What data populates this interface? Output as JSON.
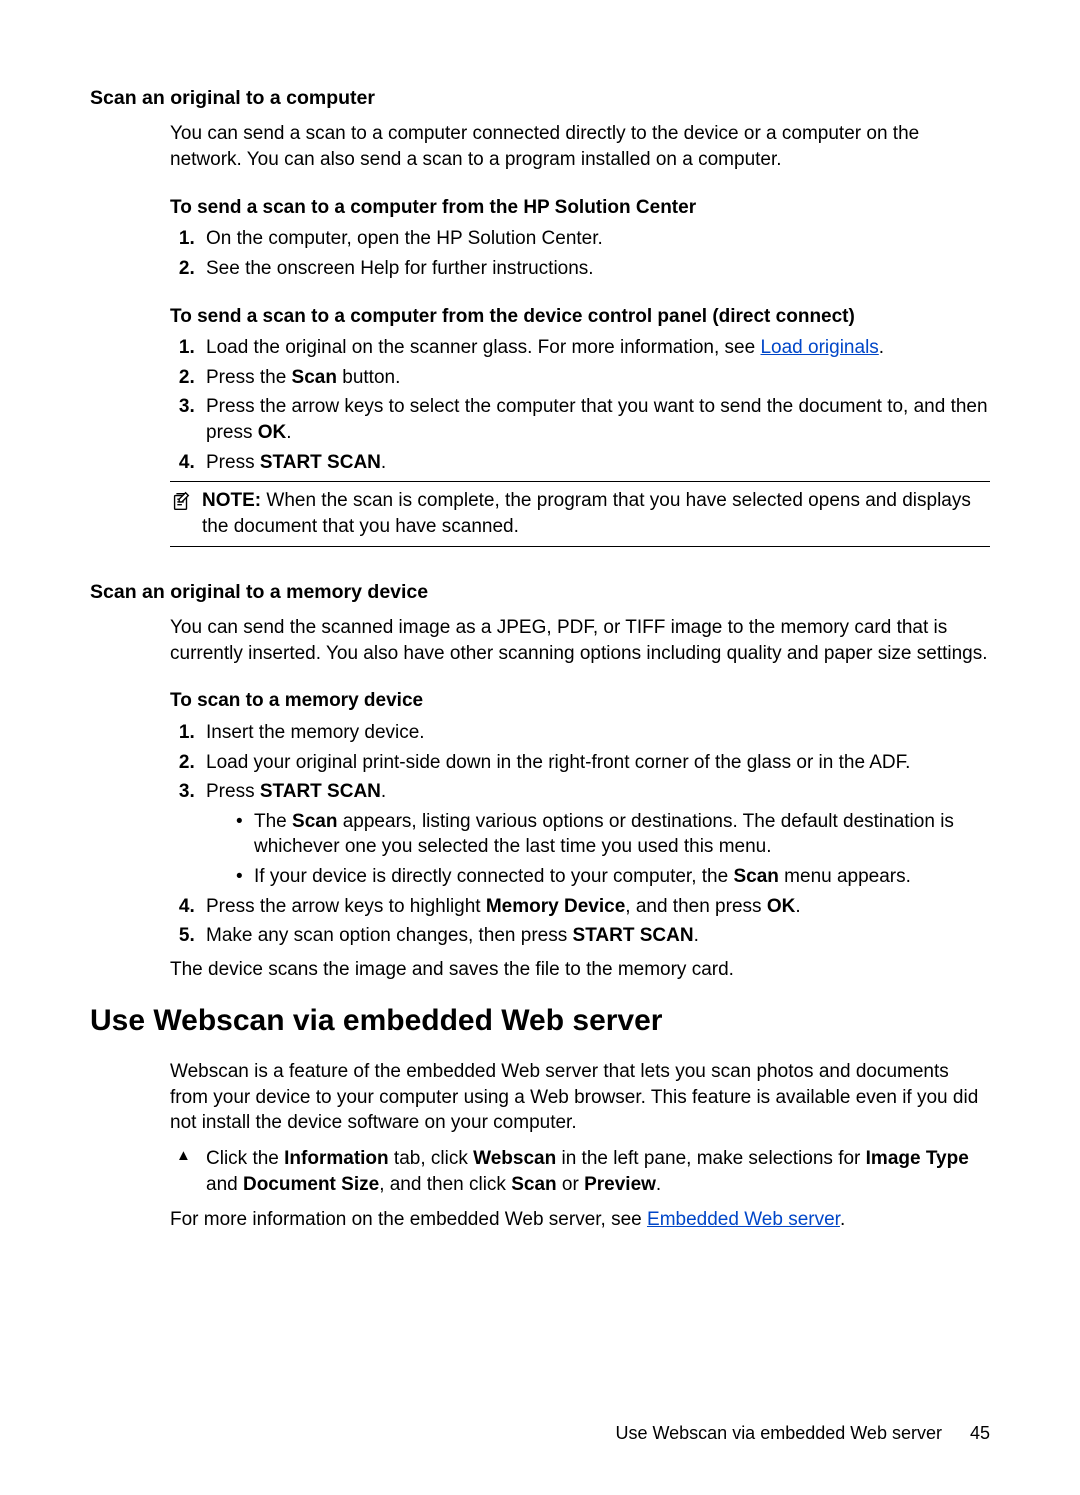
{
  "sec1": {
    "heading": "Scan an original to a computer",
    "intro": "You can send a scan to a computer connected directly to the device or a computer on the network. You can also send a scan to a program installed on a computer.",
    "sub1": {
      "heading": "To send a scan to a computer from the HP Solution Center",
      "step1": "On the computer, open the HP Solution Center.",
      "step2": "See the onscreen Help for further instructions."
    },
    "sub2": {
      "heading": "To send a scan to a computer from the device control panel (direct connect)",
      "step1_a": "Load the original on the scanner glass. For more information, see ",
      "step1_link": "Load originals",
      "step1_b": ".",
      "step2_a": "Press the ",
      "step2_strong": "Scan",
      "step2_b": " button.",
      "step3_a": "Press the arrow keys to select the computer that you want to send the document to, and then press ",
      "step3_strong": "OK",
      "step3_b": ".",
      "step4_a": "Press ",
      "step4_strong": "START SCAN",
      "step4_b": "."
    },
    "note": {
      "label": "NOTE:",
      "text": "  When the scan is complete, the program that you have selected opens and displays the document that you have scanned."
    }
  },
  "sec2": {
    "heading": "Scan an original to a memory device",
    "intro": "You can send the scanned image as a JPEG, PDF, or TIFF image to the memory card that is currently inserted. You also have other scanning options including quality and paper size settings.",
    "sub1": {
      "heading": "To scan to a memory device",
      "step1": "Insert the memory device.",
      "step2": "Load your original print-side down in the right-front corner of the glass or in the ADF.",
      "step3_a": "Press ",
      "step3_strong": "START SCAN",
      "step3_b": ".",
      "bullet1_a": "The ",
      "bullet1_strong": "Scan",
      "bullet1_b": " appears, listing various options or destinations. The default destination is whichever one you selected the last time you used this menu.",
      "bullet2_a": "If your device is directly connected to your computer, the ",
      "bullet2_strong": "Scan",
      "bullet2_b": " menu appears.",
      "step4_a": "Press the arrow keys to highlight ",
      "step4_strong1": "Memory Device",
      "step4_mid": ", and then press ",
      "step4_strong2": "OK",
      "step4_b": ".",
      "step5_a": "Make any scan option changes, then press ",
      "step5_strong": "START SCAN",
      "step5_b": "."
    },
    "outro": "The device scans the image and saves the file to the memory card."
  },
  "sec3": {
    "heading": "Use Webscan via embedded Web server",
    "intro": "Webscan is a feature of the embedded Web server that lets you scan photos and documents from your device to your computer using a Web browser. This feature is available even if you did not install the device software on your computer.",
    "step_a": "Click the ",
    "step_s1": "Information",
    "step_b": " tab, click ",
    "step_s2": "Webscan",
    "step_c": " in the left pane, make selections for ",
    "step_s3": "Image Type",
    "step_d": " and ",
    "step_s4": "Document Size",
    "step_e": ", and then click ",
    "step_s5": "Scan",
    "step_f": " or ",
    "step_s6": "Preview",
    "step_g": ".",
    "outro_a": "For more information on the embedded Web server, see ",
    "outro_link": "Embedded Web server",
    "outro_b": "."
  },
  "footer": {
    "text": "Use Webscan via embedded Web server",
    "page": "45"
  }
}
